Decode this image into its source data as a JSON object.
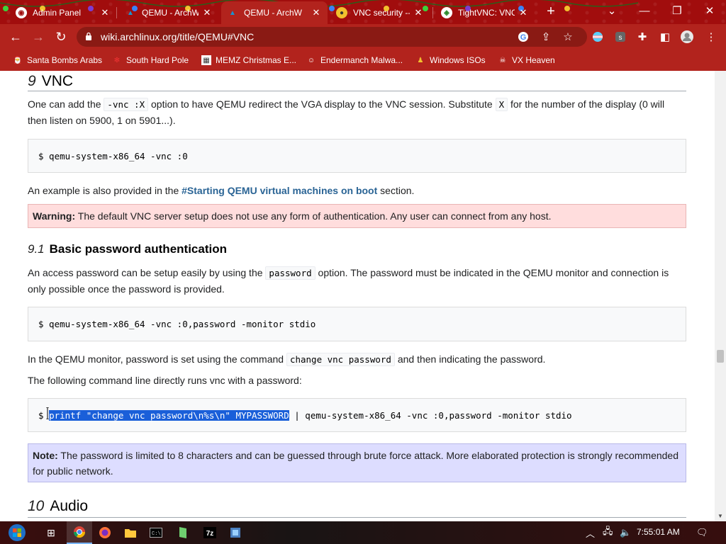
{
  "browser": {
    "tabs": [
      {
        "title": "Admin Panel",
        "active": false
      },
      {
        "title": "QEMU - ArchW",
        "active": false
      },
      {
        "title": "QEMU - ArchW",
        "active": true
      },
      {
        "title": "VNC security --",
        "active": false
      },
      {
        "title": "TightVNC: VNC",
        "active": false
      }
    ],
    "url": "wiki.archlinux.org/title/QEMU#VNC",
    "bookmarks": [
      {
        "label": "Santa Bombs Arabs"
      },
      {
        "label": "South Hard Pole"
      },
      {
        "label": "MEMZ Christmas E..."
      },
      {
        "label": "Endermanch Malwa..."
      },
      {
        "label": "Windows ISOs"
      },
      {
        "label": "VX Heaven"
      }
    ],
    "colors": {
      "frame": "#b2231d",
      "tabstrip": "#a10d0d"
    }
  },
  "article": {
    "section_vnc": {
      "number": "9",
      "title": "VNC"
    },
    "intro": {
      "part1": "One can add the ",
      "code1": "-vnc :X",
      "part2": " option to have QEMU redirect the VGA display to the VNC session. Substitute ",
      "code2": "X",
      "part3": " for the number of the display (0 will then listen on 5900, 1 on 5901...)."
    },
    "cmd1": "$ qemu-system-x86_64 -vnc :0",
    "example": {
      "part1": "An example is also provided in the ",
      "link": "#Starting QEMU virtual machines on boot",
      "part2": " section."
    },
    "warning": {
      "label": "Warning:",
      "text": " The default VNC server setup does not use any form of authentication. Any user can connect from any host."
    },
    "section_pw": {
      "number": "9.1",
      "title": "Basic password authentication"
    },
    "pw_para": {
      "part1": "An access password can be setup easily by using the ",
      "code": "password",
      "part2": " option. The password must be indicated in the QEMU monitor and connection is only possible once the password is provided."
    },
    "cmd2": "$ qemu-system-x86_64 -vnc :0,password -monitor stdio",
    "monitor_para": {
      "part1": "In the QEMU monitor, password is set using the command ",
      "code": "change vnc password",
      "part2": " and then indicating the password."
    },
    "direct_para": "The following command line directly runs vnc with a password:",
    "cmd3": {
      "prompt": "$ ",
      "selected": "printf \"change vnc password\\n%s\\n\" MYPASSWORD",
      "rest": " | qemu-system-x86_64 -vnc :0,password -monitor stdio"
    },
    "note": {
      "label": "Note:",
      "text": " The password is limited to 8 characters and can be guessed through brute force attack. More elaborated protection is strongly recommended for public network."
    },
    "section_audio": {
      "number": "10",
      "title": "Audio"
    }
  },
  "taskbar": {
    "apps": [
      "chrome-icon",
      "firefox-icon",
      "file-explorer-icon",
      "cmd-icon",
      "notepad-icon",
      "7zip-icon",
      "tool-icon"
    ],
    "clock": "7:55:01 AM"
  }
}
